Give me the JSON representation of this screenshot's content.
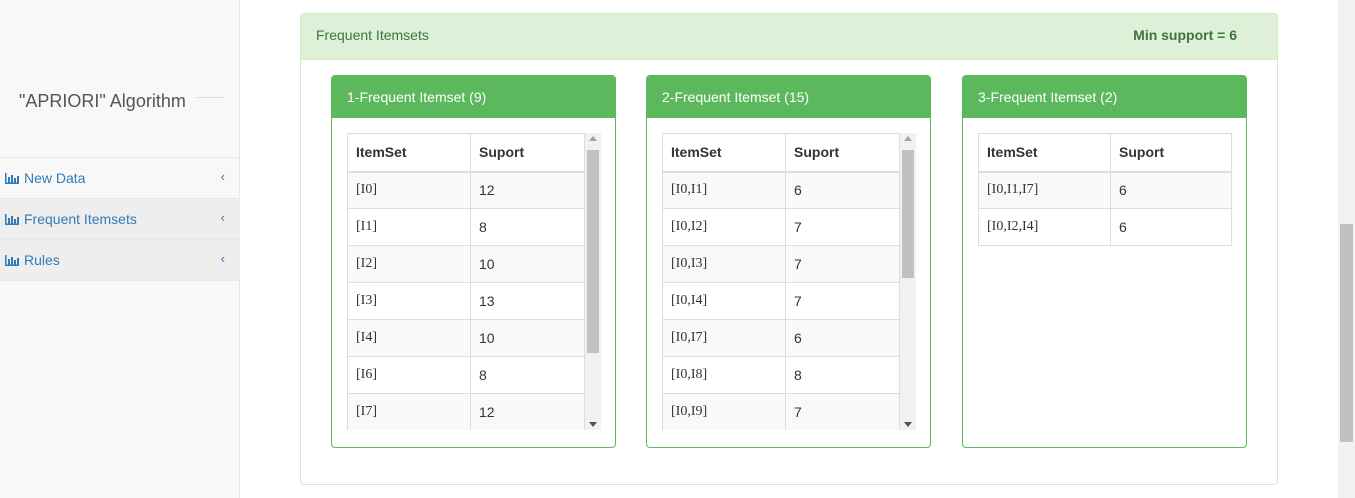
{
  "sidebar": {
    "brand": "\"APRIORI\" Algorithm",
    "items": [
      {
        "label": "New Data",
        "icon": "bar-chart-icon",
        "chevron": "‹"
      },
      {
        "label": "Frequent Itemsets",
        "icon": "bar-chart-icon",
        "chevron": "‹"
      },
      {
        "label": "Rules",
        "icon": "bar-chart-icon",
        "chevron": "‹"
      }
    ]
  },
  "panel": {
    "title": "Frequent Itemsets",
    "min_support": "Min support = 6"
  },
  "cards": [
    {
      "title": "1-Frequent Itemset (9)",
      "headers": [
        "ItemSet",
        "Suport"
      ],
      "rows": [
        [
          "[I0]",
          "12"
        ],
        [
          "[I1]",
          "8"
        ],
        [
          "[I2]",
          "10"
        ],
        [
          "[I3]",
          "13"
        ],
        [
          "[I4]",
          "10"
        ],
        [
          "[I6]",
          "8"
        ],
        [
          "[I7]",
          "12"
        ],
        [
          "",
          ""
        ]
      ]
    },
    {
      "title": "2-Frequent Itemset (15)",
      "headers": [
        "ItemSet",
        "Suport"
      ],
      "rows": [
        [
          "[I0,I1]",
          "6"
        ],
        [
          "[I0,I2]",
          "7"
        ],
        [
          "[I0,I3]",
          "7"
        ],
        [
          "[I0,I4]",
          "7"
        ],
        [
          "[I0,I7]",
          "6"
        ],
        [
          "[I0,I8]",
          "8"
        ],
        [
          "[I0,I9]",
          "7"
        ],
        [
          "",
          ""
        ]
      ]
    },
    {
      "title": "3-Frequent Itemset (2)",
      "headers": [
        "ItemSet",
        "Suport"
      ],
      "rows": [
        [
          "[I0,I1,I7]",
          "6"
        ],
        [
          "[I0,I2,I4]",
          "6"
        ]
      ]
    }
  ],
  "colors": {
    "success": "#5cb85c",
    "panel_bg": "#dff0d8",
    "panel_text": "#3c763d",
    "link": "#337ab7"
  }
}
